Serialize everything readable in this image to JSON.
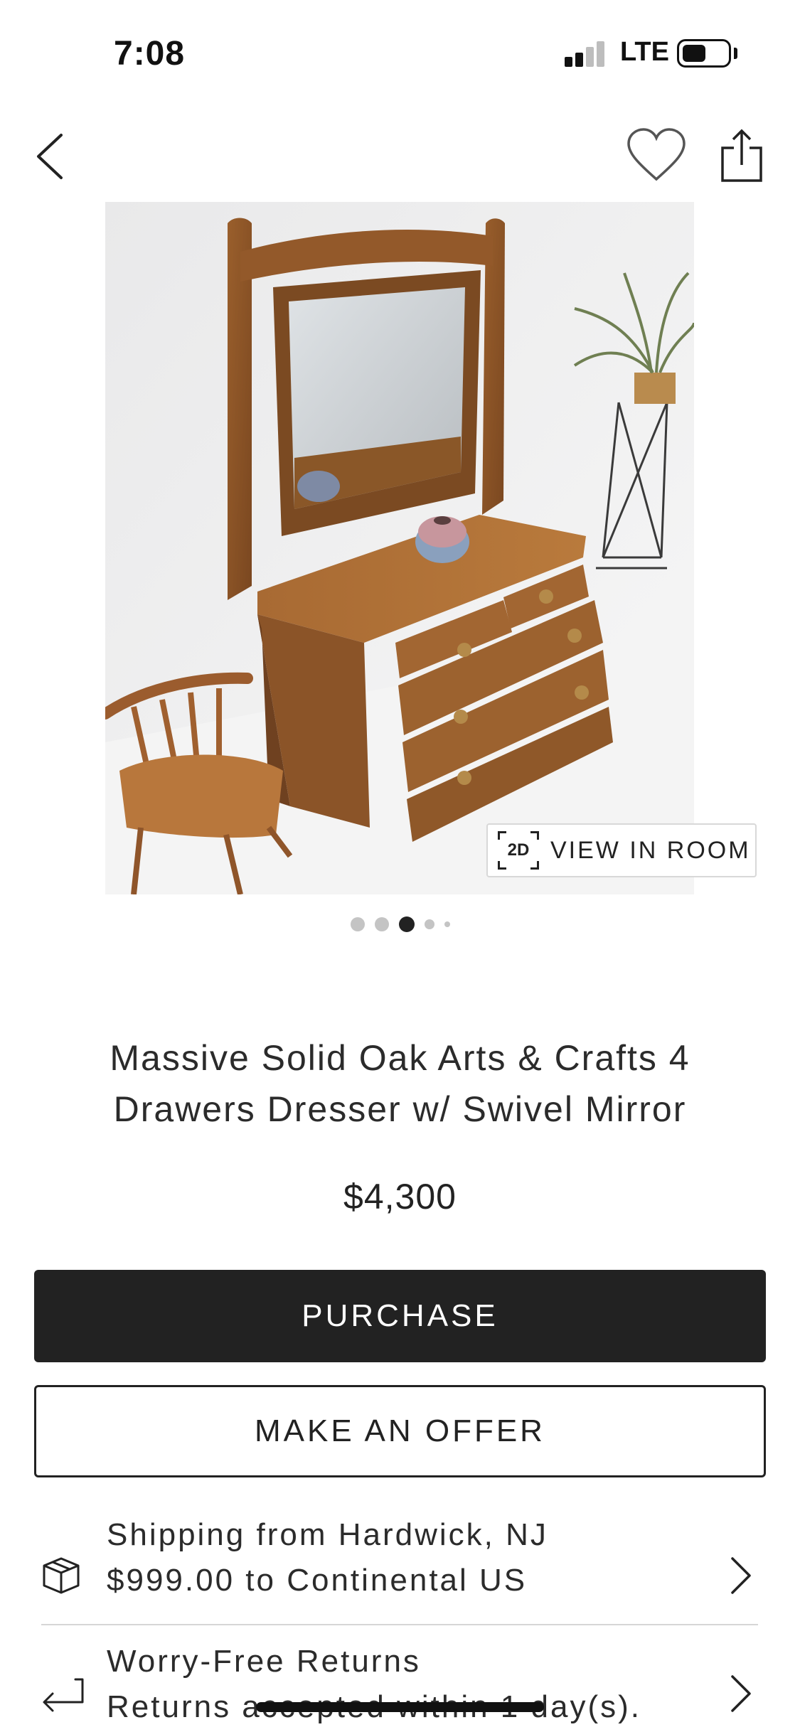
{
  "status_bar": {
    "time": "7:08",
    "carrier": "LTE"
  },
  "nav": {
    "back_icon": "chevron-left-icon",
    "favorite_icon": "heart-icon",
    "share_icon": "share-icon"
  },
  "gallery": {
    "image_count": 5,
    "active_index": 2,
    "view_in_room": {
      "badge": "2D",
      "label": "VIEW IN ROOM"
    }
  },
  "product": {
    "title": "Massive Solid Oak Arts & Crafts 4 Drawers Dresser w/ Swivel Mirror",
    "price": "$4,300"
  },
  "actions": {
    "purchase_label": "PURCHASE",
    "offer_label": "MAKE AN OFFER"
  },
  "info": {
    "shipping": {
      "title": "Shipping from Hardwick, NJ",
      "detail": "$999.00 to Continental US",
      "icon": "package-icon"
    },
    "returns": {
      "title": "Worry-Free Returns",
      "detail": "Returns accepted within 1 day(s).",
      "icon": "return-arrow-icon"
    }
  },
  "colors": {
    "primary_button": "#222222",
    "background": "#ffffff",
    "dot_active": "#222222",
    "dot_inactive": "#c4c4c4"
  }
}
